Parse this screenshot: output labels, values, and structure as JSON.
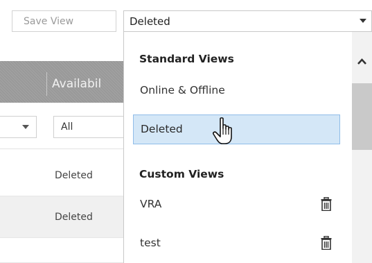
{
  "toolbar": {
    "save_view_label": "Save View",
    "selected_view": "Deleted"
  },
  "grid": {
    "column_header": "Availabil",
    "filter": {
      "value": "All"
    },
    "rows": [
      {
        "status": "Deleted"
      },
      {
        "status": "Deleted"
      }
    ]
  },
  "dropdown": {
    "standard_header": "Standard Views",
    "standard_items": [
      {
        "label": "Online & Offline"
      },
      {
        "label": "Deleted",
        "selected": true
      }
    ],
    "custom_header": "Custom Views",
    "custom_items": [
      {
        "label": "VRA"
      },
      {
        "label": "test"
      }
    ]
  },
  "icons": [
    "chevron-down-icon",
    "chevron-up-icon",
    "trash-icon",
    "hand-pointer-icon"
  ],
  "colors": {
    "selected_bg": "#d4e7f7",
    "selected_border": "#8fbce8",
    "header_bg": "#999999"
  }
}
